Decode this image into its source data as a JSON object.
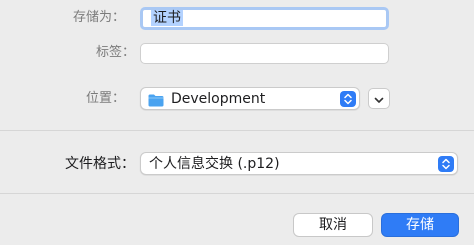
{
  "save_as": {
    "label": "存储为：",
    "value": "证书"
  },
  "tags": {
    "label": "标签：",
    "value": ""
  },
  "where": {
    "label": "位置：",
    "selected": "Development",
    "folder_color": "#4aa3f0"
  },
  "file_format": {
    "label": "文件格式：",
    "selected": "个人信息交换 (.p12)"
  },
  "buttons": {
    "cancel": "取消",
    "save": "存储"
  },
  "colors": {
    "accent": "#2f7cf6",
    "selection": "#b3d2ff",
    "focus_ring": "#a9c8f4",
    "background": "#ececec"
  }
}
